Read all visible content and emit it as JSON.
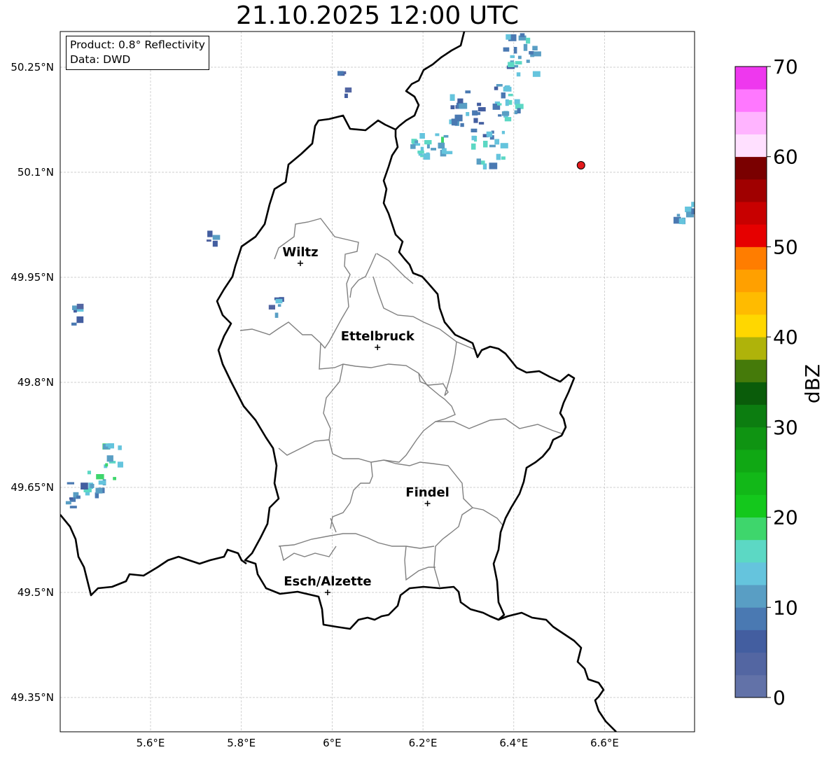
{
  "title": "21.10.2025 12:00 UTC",
  "info": {
    "product": "Product: 0.8° Reflectivity",
    "data_source": "Data: DWD"
  },
  "map": {
    "lon_range": [
      5.4,
      6.8
    ],
    "lat_range": [
      49.3,
      50.3
    ],
    "lon_ticks": [
      {
        "value": 5.6,
        "label": "5.6°E"
      },
      {
        "value": 5.8,
        "label": "5.8°E"
      },
      {
        "value": 6.0,
        "label": "6°E"
      },
      {
        "value": 6.2,
        "label": "6.2°E"
      },
      {
        "value": 6.4,
        "label": "6.4°E"
      },
      {
        "value": 6.6,
        "label": "6.6°E"
      }
    ],
    "lat_ticks": [
      {
        "value": 50.25,
        "label": "50.25°N"
      },
      {
        "value": 50.1,
        "label": "50.1°N"
      },
      {
        "value": 49.95,
        "label": "49.95°N"
      },
      {
        "value": 49.8,
        "label": "49.8°N"
      },
      {
        "value": 49.65,
        "label": "49.65°N"
      },
      {
        "value": 49.5,
        "label": "49.5°N"
      },
      {
        "value": 49.35,
        "label": "49.35°N"
      }
    ],
    "cities": [
      {
        "name": "Wiltz",
        "lon": 5.93,
        "lat": 49.97
      },
      {
        "name": "Ettelbruck",
        "lon": 6.1,
        "lat": 49.85
      },
      {
        "name": "Findel",
        "lon": 6.21,
        "lat": 49.627
      },
      {
        "name": "Esch/Alzette",
        "lon": 5.99,
        "lat": 49.5
      }
    ],
    "radar_site": {
      "lon": 6.548,
      "lat": 50.11,
      "color": "#e31a1c"
    }
  },
  "colorbar": {
    "label": "dBZ",
    "min": 0,
    "max": 70,
    "ticks": [
      "0",
      "10",
      "20",
      "30",
      "40",
      "50",
      "60",
      "70"
    ],
    "colors": [
      "#6272a8",
      "#5366a2",
      "#435ea0",
      "#4a79b2",
      "#599ec4",
      "#65c4dd",
      "#5cd8c4",
      "#3ed66c",
      "#14c81c",
      "#12b818",
      "#10a814",
      "#0f9412",
      "#0c7d10",
      "#0a5c0a",
      "#457a0a",
      "#afb30a",
      "#ffd700",
      "#ffbb00",
      "#ffa000",
      "#ff7d00",
      "#e60000",
      "#c80000",
      "#a00000",
      "#7a0000",
      "#ffe0ff",
      "#ffb4ff",
      "#ff78ff",
      "#ee38ee"
    ]
  },
  "chart_data": {
    "type": "heatmap",
    "title": "21.10.2025 12:00 UTC",
    "xlabel": "",
    "ylabel": "",
    "xlim": [
      5.4,
      6.8
    ],
    "ylim": [
      49.3,
      50.3
    ],
    "colorbar_label": "dBZ",
    "colorbar_range": [
      0,
      70
    ],
    "echoes": [
      {
        "lon": 6.41,
        "lat": 50.27,
        "approx_dbz": 12
      },
      {
        "lon": 6.38,
        "lat": 50.2,
        "approx_dbz": 12
      },
      {
        "lon": 6.29,
        "lat": 50.19,
        "approx_dbz": 10
      },
      {
        "lon": 6.21,
        "lat": 50.14,
        "approx_dbz": 15
      },
      {
        "lon": 6.34,
        "lat": 50.13,
        "approx_dbz": 12
      },
      {
        "lon": 6.02,
        "lat": 50.23,
        "approx_dbz": 8
      },
      {
        "lon": 6.77,
        "lat": 50.04,
        "approx_dbz": 10
      },
      {
        "lon": 5.51,
        "lat": 49.69,
        "approx_dbz": 15
      },
      {
        "lon": 5.47,
        "lat": 49.66,
        "approx_dbz": 14
      },
      {
        "lon": 5.43,
        "lat": 49.64,
        "approx_dbz": 10
      },
      {
        "lon": 5.43,
        "lat": 49.9,
        "approx_dbz": 8
      },
      {
        "lon": 5.87,
        "lat": 49.91,
        "approx_dbz": 8
      },
      {
        "lon": 5.73,
        "lat": 50.01,
        "approx_dbz": 6
      }
    ]
  }
}
